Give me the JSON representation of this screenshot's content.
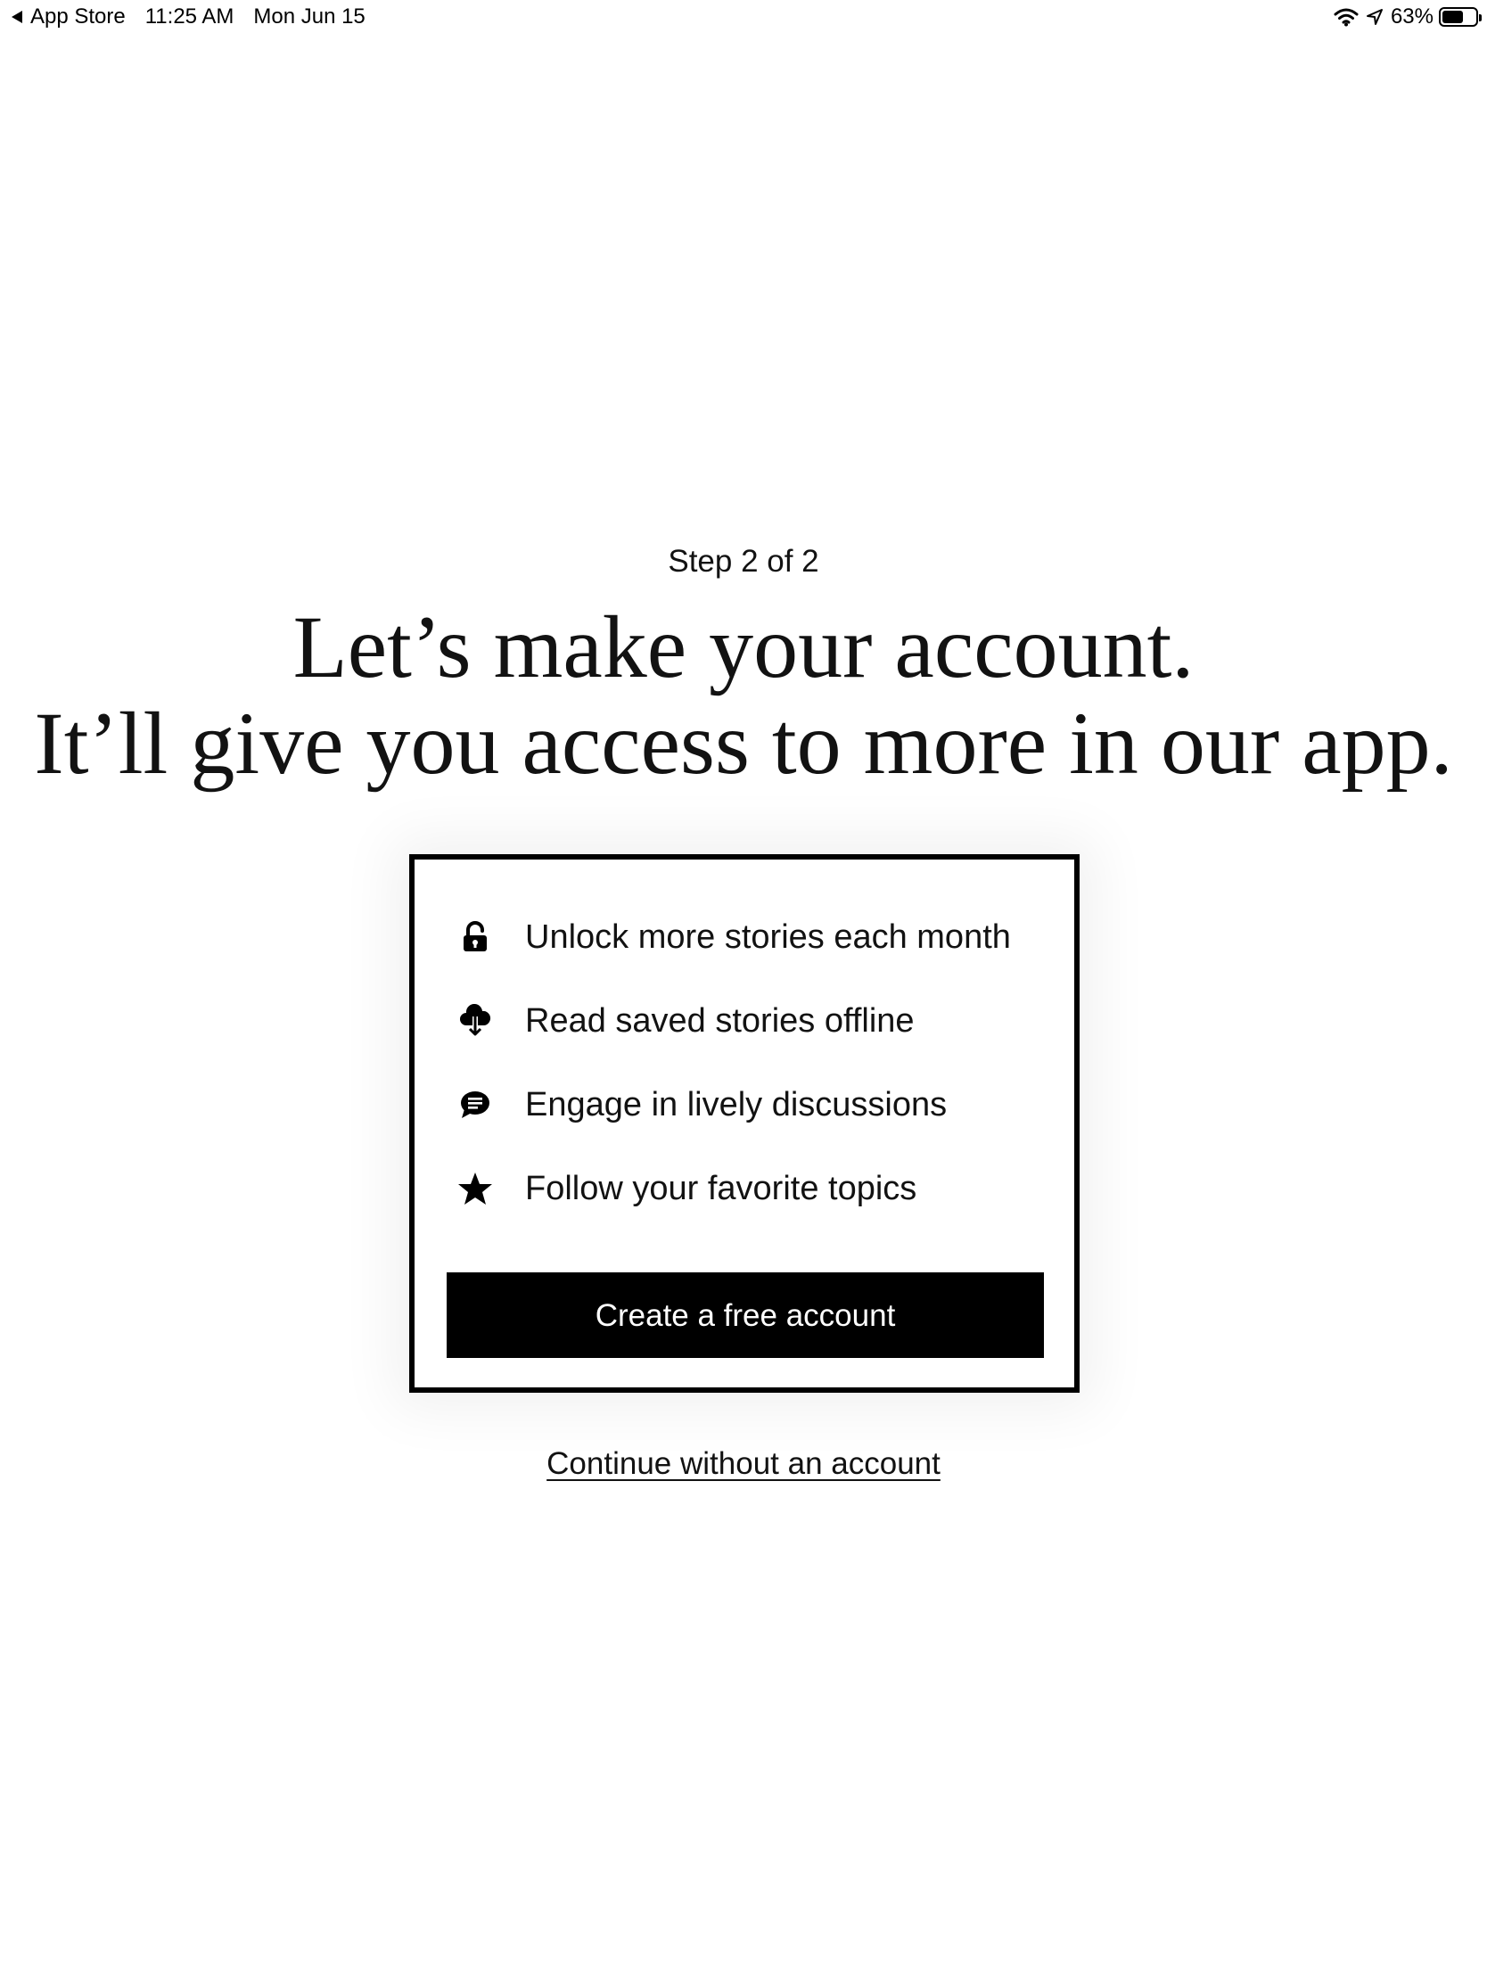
{
  "status_bar": {
    "back_app": "App Store",
    "time": "11:25 AM",
    "date": "Mon Jun 15",
    "battery_percent": "63%",
    "battery_level": 0.63,
    "icons": [
      "back-arrow-icon",
      "wifi-icon",
      "location-icon",
      "battery-icon"
    ]
  },
  "onboarding": {
    "step": "Step 2 of 2",
    "headline_line1": "Let’s make your account.",
    "headline_line2": "It’ll give you access to more in our app.",
    "benefits": [
      {
        "icon": "unlock-icon",
        "label": "Unlock more stories each month"
      },
      {
        "icon": "cloud-download-icon",
        "label": "Read saved stories offline"
      },
      {
        "icon": "comment-icon",
        "label": "Engage in lively discussions"
      },
      {
        "icon": "star-icon",
        "label": "Follow your favorite topics"
      }
    ],
    "create_button": "Create a free account",
    "continue_link": "Continue without an account"
  }
}
